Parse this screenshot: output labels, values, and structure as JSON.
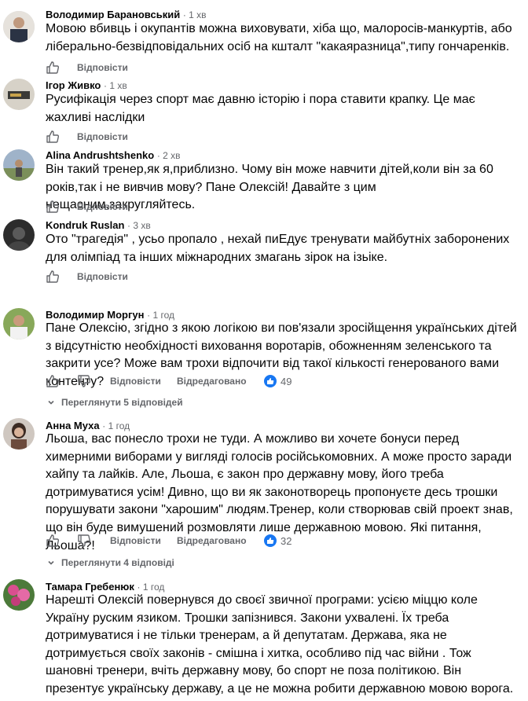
{
  "comments": [
    {
      "author": "Володимир Барановський",
      "time": "1 хв",
      "text": "Мовою вбивць і окупантів можна виховувати, хіба що, малоросів-манкуртів, або ліберально-безвідповідальних осіб на кшталт \"какаяразница\",типу гончаренків.",
      "reply_label": "Відповісти"
    },
    {
      "author": "Ігор Живко",
      "time": "1 хв",
      "text": "Русифікація через спорт має давню історію і пора ставити крапку. Це має жахливі наслідки",
      "reply_label": "Відповісти"
    },
    {
      "author": "Alina Andrushtshenko",
      "time": "2 хв",
      "text": "Він такий тренер,як я,приблизно. Чому він може навчити дітей,коли він за 60 років,так і не вивчив мову? Пане Олексій! Давайте з цим нещасним,закругляйтесь.",
      "reply_label": "Відповісти"
    },
    {
      "author": "Kondruk Ruslan",
      "time": "3 хв",
      "text": "Ото \"трагедія\" , усьо пропало , нехай пиЕдує тренувати майбутніх заборонених для олімпіад та інших міжнародних змагань зірок на ізьіке.",
      "reply_label": "Відповісти"
    },
    {
      "author": "Володимир Моргун",
      "time": "1 год",
      "text": "Пане Олексію, згідно з якою логікою ви пов'язали зросійщення українських дітей з відсутністю необхідності виховання воротарів, обожненням зеленського та закрити усе? Може вам трохи відпочити від такої кількості генерованого вами контенту?",
      "reply_label": "Відповісти",
      "edited_label": "Відредаговано",
      "reactions": "49",
      "view_replies": "Переглянути 5 відповідей"
    },
    {
      "author": "Анна Муха",
      "time": "1 год",
      "text": "Льоша, вас понесло трохи не туди. А можливо ви хочете бонуси перед химерними виборами у вигляді голосів російськомовних. А може просто заради хайпу та лайків. Але, Льоша, є закон про державну мову, його треба дотримуватися усім! Дивно, що ви як законотворець пропонуєте десь трошки порушувати закони \"харошим\" людям.Тренер, коли створював свій проект знав, що він буде вимушений розмовляти лише державною мовою. Які питання, Льоша?!",
      "reply_label": "Відповісти",
      "edited_label": "Відредаговано",
      "reactions": "32",
      "view_replies": "Переглянути 4 відповіді"
    },
    {
      "author": "Тамара Гребенюк",
      "time": "1 год",
      "text": "Нарешті Олексій повернувся до своєї звичної програми: усією міццю коле Україну руским язиком. Трошки запізнився. Закони ухвалені. Їх треба дотримуватися і не тільки тренерам, а й депутатам. Держава, яка не дотримується своїх законів - смішна і хитка, особливо під час війни . Тож шановні тренери, вчіть державну мову, бо спорт не поза політикою. Він презентує українську державу, а це не можна робити державною мовою ворога."
    }
  ],
  "colors": {
    "meta": "#65676b",
    "text": "#050505",
    "like": "#1877f2"
  }
}
